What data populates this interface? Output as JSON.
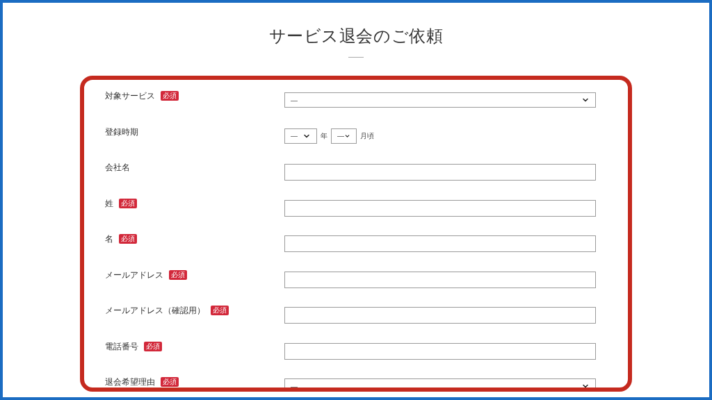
{
  "title": "サービス退会のご依頼",
  "fields": [
    {
      "label": "対象サービス",
      "badge": "必須",
      "kind": "select",
      "value": "—"
    },
    {
      "label": "登録時期",
      "kind": "date",
      "year_value": "—",
      "year_unit": "年",
      "month_value": "—",
      "month_unit": "月頃"
    },
    {
      "label": "会社名",
      "kind": "text"
    },
    {
      "label": "姓",
      "badge": "必須",
      "kind": "text"
    },
    {
      "label": "名",
      "badge": "必須",
      "kind": "text"
    },
    {
      "label": "メールアドレス",
      "badge": "必須",
      "kind": "text"
    },
    {
      "label": "メールアドレス（確認用）",
      "badge": "必須",
      "kind": "text"
    },
    {
      "label": "電話番号",
      "badge": "必須",
      "kind": "text"
    },
    {
      "label": "退会希望理由",
      "badge": "必須",
      "kind": "select",
      "value": "—"
    }
  ]
}
